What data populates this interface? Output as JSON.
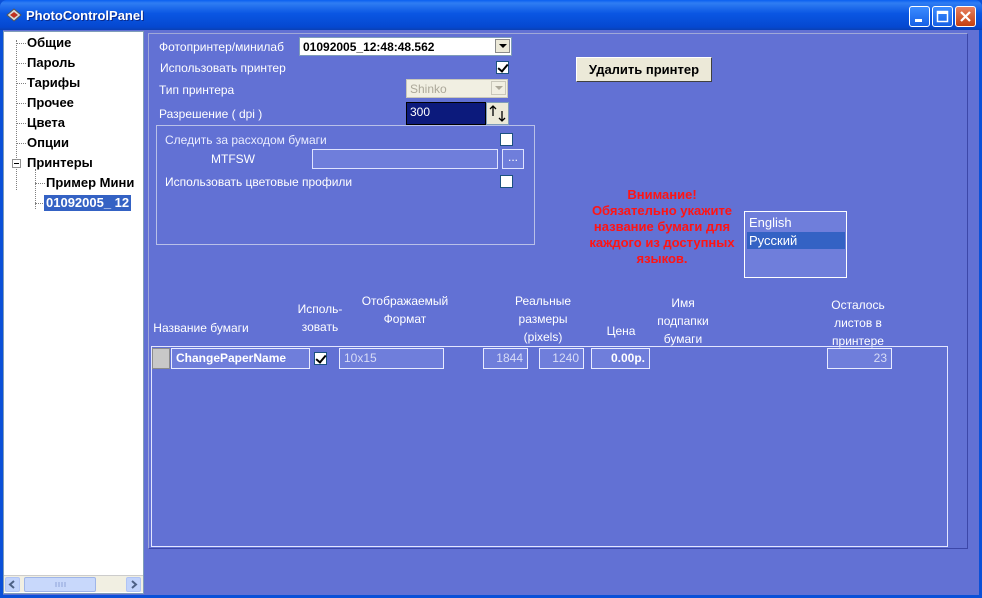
{
  "window": {
    "title": "PhotoControlPanel"
  },
  "tree": {
    "items": [
      {
        "label": "Общие"
      },
      {
        "label": "Пароль"
      },
      {
        "label": "Тарифы"
      },
      {
        "label": "Прочее"
      },
      {
        "label": "Цвета"
      },
      {
        "label": "Опции"
      },
      {
        "label": "Принтеры"
      },
      {
        "label": "Пример Мини"
      },
      {
        "label": "01092005_ 12"
      }
    ]
  },
  "printer": {
    "label": "Фотопринтер/минилаб",
    "value": "01092005_12:48:48.562",
    "use_label": "Использовать принтер",
    "type_label": "Тип принтера",
    "type_value": "Shinko",
    "resolution_label": "Разрешение   ( dpi )",
    "resolution_value": "300",
    "delete_button": "Удалить принтер"
  },
  "paper_group": {
    "track_label": "Следить за расходом бумаги",
    "mtfsw_label": "MTFSW",
    "mtfsw_value": "",
    "browse_label": "...",
    "profiles_label": "Использовать цветовые профили"
  },
  "warning": {
    "line1": "Внимание!",
    "line2": "Обязательно укажите",
    "line3": "название бумаги для",
    "line4": "каждого из доступных",
    "line5": "языков."
  },
  "languages": {
    "items": [
      "English",
      "Русский"
    ],
    "selected": "Русский"
  },
  "grid": {
    "headers": {
      "name": "Название бумаги",
      "use1": "Исполь-",
      "use2": "зовать",
      "format1": "Отображаемый",
      "format2": "Формат",
      "size1": "Реальные",
      "size2": "размеры",
      "size3": "(pixels)",
      "price": "Цена",
      "folder1": "Имя",
      "folder2": "подпапки",
      "folder3": "бумаги",
      "left1": "Осталось",
      "left2": "листов в",
      "left3": "принтере"
    },
    "rows": [
      {
        "name": "ChangePaperName",
        "use": true,
        "format": "10x15",
        "width": "1844",
        "height": "1240",
        "price": "0.00р.",
        "remaining": "23"
      }
    ]
  },
  "colors": {
    "background": "#6271d4",
    "titlebar": "#0a56e3",
    "warning": "#ff1414",
    "selection": "#3462c4"
  }
}
